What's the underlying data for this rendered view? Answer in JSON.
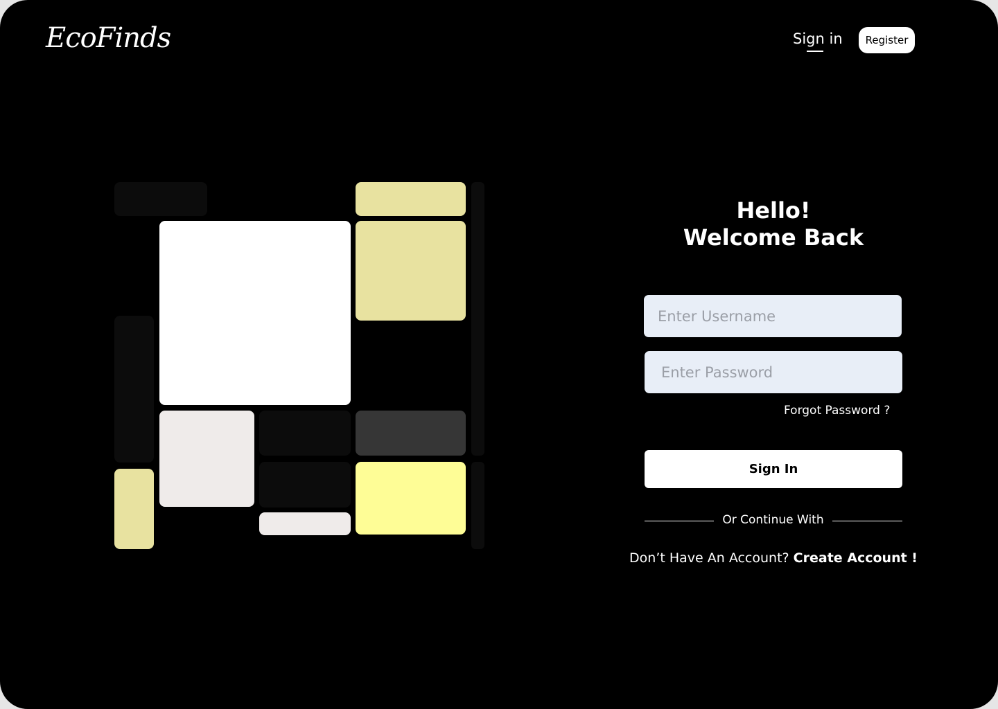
{
  "header": {
    "logo": "EcoFinds",
    "nav_signin": "Sign in",
    "nav_register": "Register"
  },
  "mosaic": {
    "colors": {
      "near_black": "#0c0c0c",
      "white": "#ffffff",
      "khaki": "#e8e2a0",
      "off_white": "#efebea",
      "charcoal": "#363636",
      "bright_yellow": "#fefd96"
    }
  },
  "login": {
    "heading_line1": "Hello!",
    "heading_line2": "Welcome Back",
    "username_placeholder": "Enter Username",
    "password_placeholder": "Enter Password",
    "forgot_password": "Forgot Password ?",
    "signin_button": "Sign In",
    "divider_text": "Or Continue With",
    "no_account_text": "Don’t Have An Account?",
    "create_account": "Create Account !"
  }
}
